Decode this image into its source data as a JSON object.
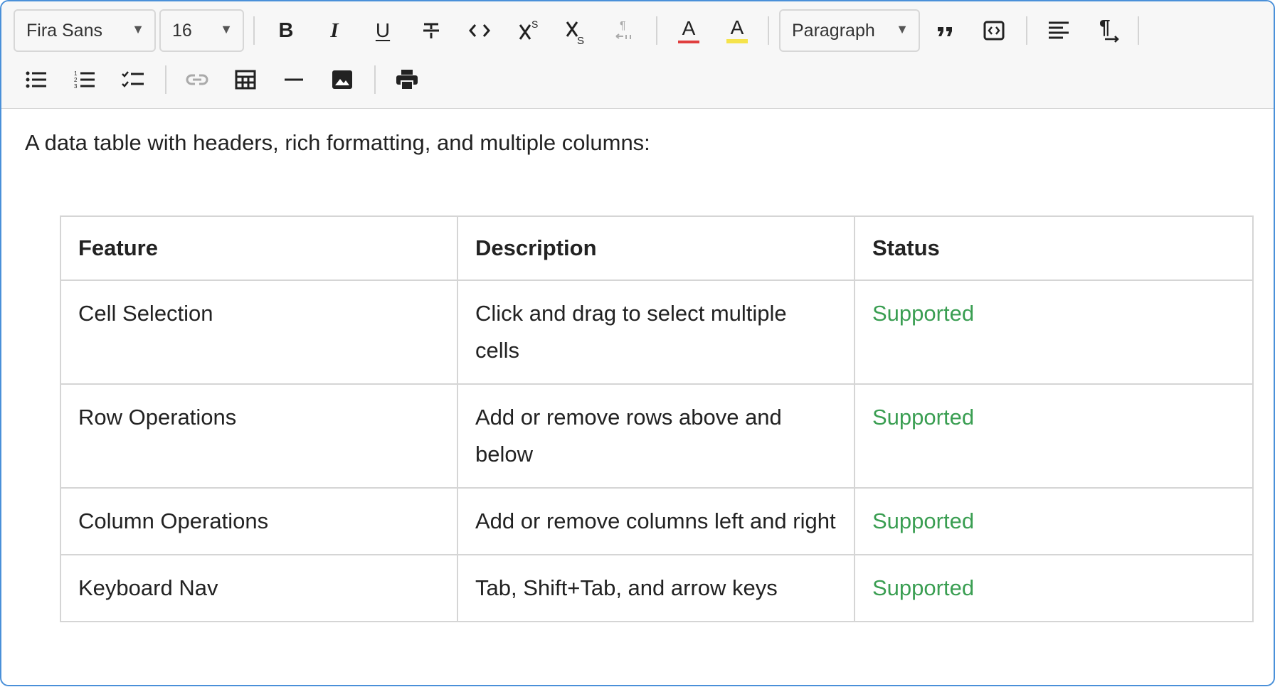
{
  "toolbar": {
    "font_family": "Fira Sans",
    "font_size": "16",
    "block_type": "Paragraph",
    "buttons": {
      "bold": "B",
      "italic": "I",
      "underline": "U",
      "text_color": "A",
      "highlight": "A"
    },
    "icons": {
      "bold": "bold-icon",
      "italic": "italic-icon",
      "underline": "underline-icon",
      "strikethrough": "strikethrough-icon",
      "code": "code-icon",
      "superscript": "superscript-icon",
      "subscript": "subscript-icon",
      "text_direction": "text-direction-icon",
      "text_color": "text-color-icon",
      "highlight": "highlight-color-icon",
      "blockquote": "blockquote-icon",
      "code_block": "code-block-icon",
      "align_left": "align-left-icon",
      "paragraph_ltr": "paragraph-direction-icon",
      "bullet_list": "bullet-list-icon",
      "ordered_list": "ordered-list-icon",
      "task_list": "task-list-icon",
      "link": "link-icon",
      "table": "table-icon",
      "horizontal_rule": "horizontal-rule-icon",
      "image": "image-icon",
      "print": "print-icon"
    },
    "colors": {
      "text_color_underline": "#e03e3e",
      "highlight_underline": "#f5e34b"
    }
  },
  "content": {
    "intro": "A data table with headers, rich formatting, and multiple columns:",
    "table": {
      "headers": [
        "Feature",
        "Description",
        "Status"
      ],
      "rows": [
        {
          "feature": "Cell Selection",
          "description": "Click and drag to select multiple cells",
          "status": "Supported"
        },
        {
          "feature": "Row Operations",
          "description": "Add or remove rows above and below",
          "status": "Supported"
        },
        {
          "feature": "Column Operations",
          "description": "Add or remove columns left and right",
          "status": "Supported"
        },
        {
          "feature": "Keyboard Nav",
          "description": "Tab, Shift+Tab, and arrow keys",
          "status": "Supported"
        }
      ]
    },
    "colors": {
      "status_supported": "#3a9e52",
      "editor_border": "#4a90d9"
    }
  }
}
